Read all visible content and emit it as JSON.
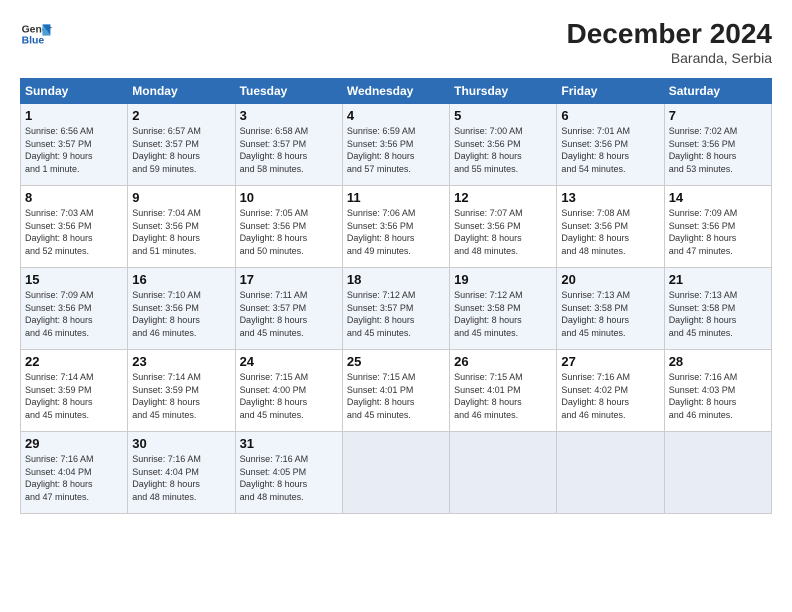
{
  "logo": {
    "line1": "General",
    "line2": "Blue"
  },
  "title": {
    "month_year": "December 2024",
    "location": "Baranda, Serbia"
  },
  "weekdays": [
    "Sunday",
    "Monday",
    "Tuesday",
    "Wednesday",
    "Thursday",
    "Friday",
    "Saturday"
  ],
  "weeks": [
    [
      {
        "day": "1",
        "info": "Sunrise: 6:56 AM\nSunset: 3:57 PM\nDaylight: 9 hours\nand 1 minute."
      },
      {
        "day": "2",
        "info": "Sunrise: 6:57 AM\nSunset: 3:57 PM\nDaylight: 8 hours\nand 59 minutes."
      },
      {
        "day": "3",
        "info": "Sunrise: 6:58 AM\nSunset: 3:57 PM\nDaylight: 8 hours\nand 58 minutes."
      },
      {
        "day": "4",
        "info": "Sunrise: 6:59 AM\nSunset: 3:56 PM\nDaylight: 8 hours\nand 57 minutes."
      },
      {
        "day": "5",
        "info": "Sunrise: 7:00 AM\nSunset: 3:56 PM\nDaylight: 8 hours\nand 55 minutes."
      },
      {
        "day": "6",
        "info": "Sunrise: 7:01 AM\nSunset: 3:56 PM\nDaylight: 8 hours\nand 54 minutes."
      },
      {
        "day": "7",
        "info": "Sunrise: 7:02 AM\nSunset: 3:56 PM\nDaylight: 8 hours\nand 53 minutes."
      }
    ],
    [
      {
        "day": "8",
        "info": "Sunrise: 7:03 AM\nSunset: 3:56 PM\nDaylight: 8 hours\nand 52 minutes."
      },
      {
        "day": "9",
        "info": "Sunrise: 7:04 AM\nSunset: 3:56 PM\nDaylight: 8 hours\nand 51 minutes."
      },
      {
        "day": "10",
        "info": "Sunrise: 7:05 AM\nSunset: 3:56 PM\nDaylight: 8 hours\nand 50 minutes."
      },
      {
        "day": "11",
        "info": "Sunrise: 7:06 AM\nSunset: 3:56 PM\nDaylight: 8 hours\nand 49 minutes."
      },
      {
        "day": "12",
        "info": "Sunrise: 7:07 AM\nSunset: 3:56 PM\nDaylight: 8 hours\nand 48 minutes."
      },
      {
        "day": "13",
        "info": "Sunrise: 7:08 AM\nSunset: 3:56 PM\nDaylight: 8 hours\nand 48 minutes."
      },
      {
        "day": "14",
        "info": "Sunrise: 7:09 AM\nSunset: 3:56 PM\nDaylight: 8 hours\nand 47 minutes."
      }
    ],
    [
      {
        "day": "15",
        "info": "Sunrise: 7:09 AM\nSunset: 3:56 PM\nDaylight: 8 hours\nand 46 minutes."
      },
      {
        "day": "16",
        "info": "Sunrise: 7:10 AM\nSunset: 3:56 PM\nDaylight: 8 hours\nand 46 minutes."
      },
      {
        "day": "17",
        "info": "Sunrise: 7:11 AM\nSunset: 3:57 PM\nDaylight: 8 hours\nand 45 minutes."
      },
      {
        "day": "18",
        "info": "Sunrise: 7:12 AM\nSunset: 3:57 PM\nDaylight: 8 hours\nand 45 minutes."
      },
      {
        "day": "19",
        "info": "Sunrise: 7:12 AM\nSunset: 3:58 PM\nDaylight: 8 hours\nand 45 minutes."
      },
      {
        "day": "20",
        "info": "Sunrise: 7:13 AM\nSunset: 3:58 PM\nDaylight: 8 hours\nand 45 minutes."
      },
      {
        "day": "21",
        "info": "Sunrise: 7:13 AM\nSunset: 3:58 PM\nDaylight: 8 hours\nand 45 minutes."
      }
    ],
    [
      {
        "day": "22",
        "info": "Sunrise: 7:14 AM\nSunset: 3:59 PM\nDaylight: 8 hours\nand 45 minutes."
      },
      {
        "day": "23",
        "info": "Sunrise: 7:14 AM\nSunset: 3:59 PM\nDaylight: 8 hours\nand 45 minutes."
      },
      {
        "day": "24",
        "info": "Sunrise: 7:15 AM\nSunset: 4:00 PM\nDaylight: 8 hours\nand 45 minutes."
      },
      {
        "day": "25",
        "info": "Sunrise: 7:15 AM\nSunset: 4:01 PM\nDaylight: 8 hours\nand 45 minutes."
      },
      {
        "day": "26",
        "info": "Sunrise: 7:15 AM\nSunset: 4:01 PM\nDaylight: 8 hours\nand 46 minutes."
      },
      {
        "day": "27",
        "info": "Sunrise: 7:16 AM\nSunset: 4:02 PM\nDaylight: 8 hours\nand 46 minutes."
      },
      {
        "day": "28",
        "info": "Sunrise: 7:16 AM\nSunset: 4:03 PM\nDaylight: 8 hours\nand 46 minutes."
      }
    ],
    [
      {
        "day": "29",
        "info": "Sunrise: 7:16 AM\nSunset: 4:04 PM\nDaylight: 8 hours\nand 47 minutes."
      },
      {
        "day": "30",
        "info": "Sunrise: 7:16 AM\nSunset: 4:04 PM\nDaylight: 8 hours\nand 48 minutes."
      },
      {
        "day": "31",
        "info": "Sunrise: 7:16 AM\nSunset: 4:05 PM\nDaylight: 8 hours\nand 48 minutes."
      },
      {
        "day": "",
        "info": ""
      },
      {
        "day": "",
        "info": ""
      },
      {
        "day": "",
        "info": ""
      },
      {
        "day": "",
        "info": ""
      }
    ]
  ]
}
